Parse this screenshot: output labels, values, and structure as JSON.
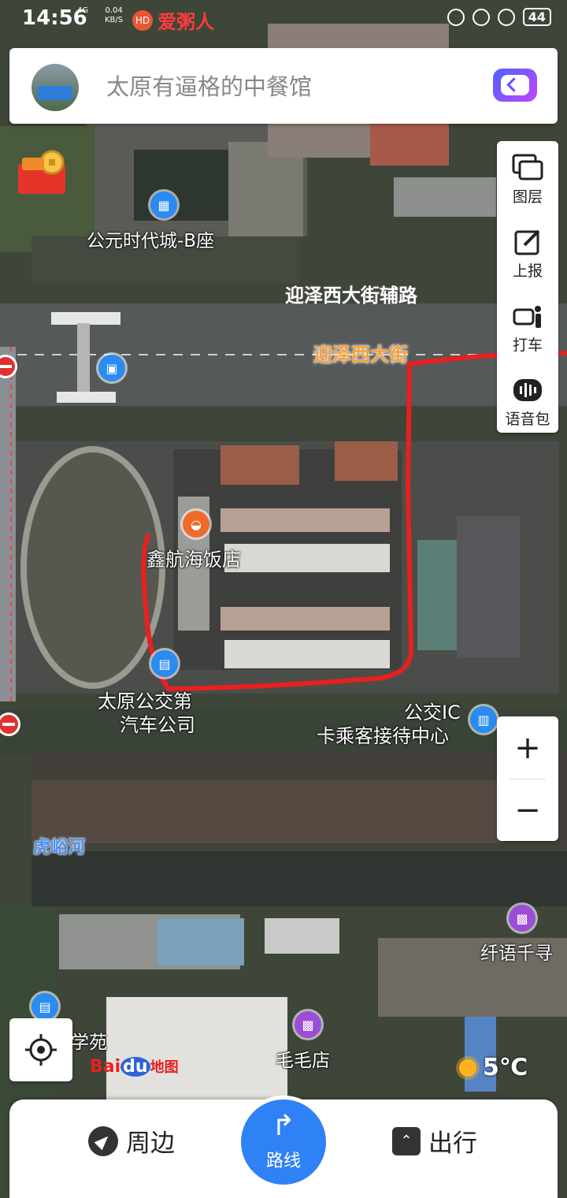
{
  "status_bar": {
    "time": "14:56",
    "signal_text": "4G",
    "net_speed": "0.04",
    "net_unit": "KB/S",
    "app_label": "爱粥人",
    "battery": "44"
  },
  "search": {
    "placeholder": "太原有逼格的中餐馆"
  },
  "tools": {
    "layers": "图层",
    "report": "上报",
    "taxi": "打车",
    "voice": "语音包"
  },
  "zoom": {
    "in": "+",
    "out": "−"
  },
  "map": {
    "labels": {
      "gongyuan": "公元时代城-B座",
      "yingze_fu": "迎泽西大街辅路",
      "yingze": "迎泽西大街",
      "xinhang": "鑫航海饭店",
      "bus_co_1": "太原公交第",
      "bus_co_2": "汽车公司",
      "ic_1": "公交IC",
      "ic_2": "卡乘客接待中心",
      "huyu": "虎峪河",
      "qianyu": "纤语千寻",
      "xueyuan": "学苑",
      "maomao": "毛毛店"
    },
    "colors": {
      "outline": "#e8201f",
      "pin_blue": "#2a8bf0",
      "pin_orange": "#f06a2a",
      "pin_purple": "#9b4dd8"
    }
  },
  "watermark": {
    "baidu": "Bai",
    "du": "du",
    "map": "地图"
  },
  "weather": {
    "temp": "5℃"
  },
  "bottom_nav": {
    "nearby": "周边",
    "route": "路线",
    "travel": "出行"
  }
}
